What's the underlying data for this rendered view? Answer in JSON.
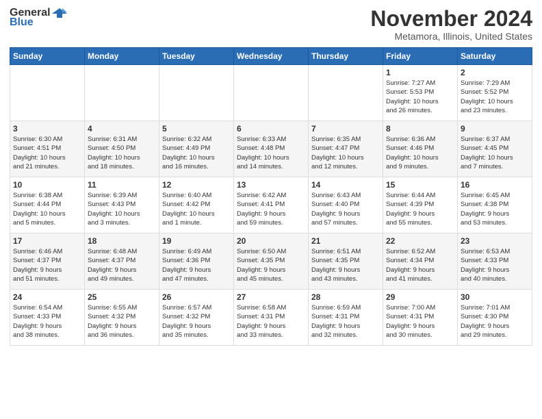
{
  "app": {
    "logo_general": "General",
    "logo_blue": "Blue"
  },
  "header": {
    "month_title": "November 2024",
    "location": "Metamora, Illinois, United States"
  },
  "days_of_week": [
    "Sunday",
    "Monday",
    "Tuesday",
    "Wednesday",
    "Thursday",
    "Friday",
    "Saturday"
  ],
  "weeks": [
    [
      {
        "day": "",
        "info": ""
      },
      {
        "day": "",
        "info": ""
      },
      {
        "day": "",
        "info": ""
      },
      {
        "day": "",
        "info": ""
      },
      {
        "day": "",
        "info": ""
      },
      {
        "day": "1",
        "info": "Sunrise: 7:27 AM\nSunset: 5:53 PM\nDaylight: 10 hours\nand 26 minutes."
      },
      {
        "day": "2",
        "info": "Sunrise: 7:29 AM\nSunset: 5:52 PM\nDaylight: 10 hours\nand 23 minutes."
      }
    ],
    [
      {
        "day": "3",
        "info": "Sunrise: 6:30 AM\nSunset: 4:51 PM\nDaylight: 10 hours\nand 21 minutes."
      },
      {
        "day": "4",
        "info": "Sunrise: 6:31 AM\nSunset: 4:50 PM\nDaylight: 10 hours\nand 18 minutes."
      },
      {
        "day": "5",
        "info": "Sunrise: 6:32 AM\nSunset: 4:49 PM\nDaylight: 10 hours\nand 16 minutes."
      },
      {
        "day": "6",
        "info": "Sunrise: 6:33 AM\nSunset: 4:48 PM\nDaylight: 10 hours\nand 14 minutes."
      },
      {
        "day": "7",
        "info": "Sunrise: 6:35 AM\nSunset: 4:47 PM\nDaylight: 10 hours\nand 12 minutes."
      },
      {
        "day": "8",
        "info": "Sunrise: 6:36 AM\nSunset: 4:46 PM\nDaylight: 10 hours\nand 9 minutes."
      },
      {
        "day": "9",
        "info": "Sunrise: 6:37 AM\nSunset: 4:45 PM\nDaylight: 10 hours\nand 7 minutes."
      }
    ],
    [
      {
        "day": "10",
        "info": "Sunrise: 6:38 AM\nSunset: 4:44 PM\nDaylight: 10 hours\nand 5 minutes."
      },
      {
        "day": "11",
        "info": "Sunrise: 6:39 AM\nSunset: 4:43 PM\nDaylight: 10 hours\nand 3 minutes."
      },
      {
        "day": "12",
        "info": "Sunrise: 6:40 AM\nSunset: 4:42 PM\nDaylight: 10 hours\nand 1 minute."
      },
      {
        "day": "13",
        "info": "Sunrise: 6:42 AM\nSunset: 4:41 PM\nDaylight: 9 hours\nand 59 minutes."
      },
      {
        "day": "14",
        "info": "Sunrise: 6:43 AM\nSunset: 4:40 PM\nDaylight: 9 hours\nand 57 minutes."
      },
      {
        "day": "15",
        "info": "Sunrise: 6:44 AM\nSunset: 4:39 PM\nDaylight: 9 hours\nand 55 minutes."
      },
      {
        "day": "16",
        "info": "Sunrise: 6:45 AM\nSunset: 4:38 PM\nDaylight: 9 hours\nand 53 minutes."
      }
    ],
    [
      {
        "day": "17",
        "info": "Sunrise: 6:46 AM\nSunset: 4:37 PM\nDaylight: 9 hours\nand 51 minutes."
      },
      {
        "day": "18",
        "info": "Sunrise: 6:48 AM\nSunset: 4:37 PM\nDaylight: 9 hours\nand 49 minutes."
      },
      {
        "day": "19",
        "info": "Sunrise: 6:49 AM\nSunset: 4:36 PM\nDaylight: 9 hours\nand 47 minutes."
      },
      {
        "day": "20",
        "info": "Sunrise: 6:50 AM\nSunset: 4:35 PM\nDaylight: 9 hours\nand 45 minutes."
      },
      {
        "day": "21",
        "info": "Sunrise: 6:51 AM\nSunset: 4:35 PM\nDaylight: 9 hours\nand 43 minutes."
      },
      {
        "day": "22",
        "info": "Sunrise: 6:52 AM\nSunset: 4:34 PM\nDaylight: 9 hours\nand 41 minutes."
      },
      {
        "day": "23",
        "info": "Sunrise: 6:53 AM\nSunset: 4:33 PM\nDaylight: 9 hours\nand 40 minutes."
      }
    ],
    [
      {
        "day": "24",
        "info": "Sunrise: 6:54 AM\nSunset: 4:33 PM\nDaylight: 9 hours\nand 38 minutes."
      },
      {
        "day": "25",
        "info": "Sunrise: 6:55 AM\nSunset: 4:32 PM\nDaylight: 9 hours\nand 36 minutes."
      },
      {
        "day": "26",
        "info": "Sunrise: 6:57 AM\nSunset: 4:32 PM\nDaylight: 9 hours\nand 35 minutes."
      },
      {
        "day": "27",
        "info": "Sunrise: 6:58 AM\nSunset: 4:31 PM\nDaylight: 9 hours\nand 33 minutes."
      },
      {
        "day": "28",
        "info": "Sunrise: 6:59 AM\nSunset: 4:31 PM\nDaylight: 9 hours\nand 32 minutes."
      },
      {
        "day": "29",
        "info": "Sunrise: 7:00 AM\nSunset: 4:31 PM\nDaylight: 9 hours\nand 30 minutes."
      },
      {
        "day": "30",
        "info": "Sunrise: 7:01 AM\nSunset: 4:30 PM\nDaylight: 9 hours\nand 29 minutes."
      }
    ]
  ]
}
